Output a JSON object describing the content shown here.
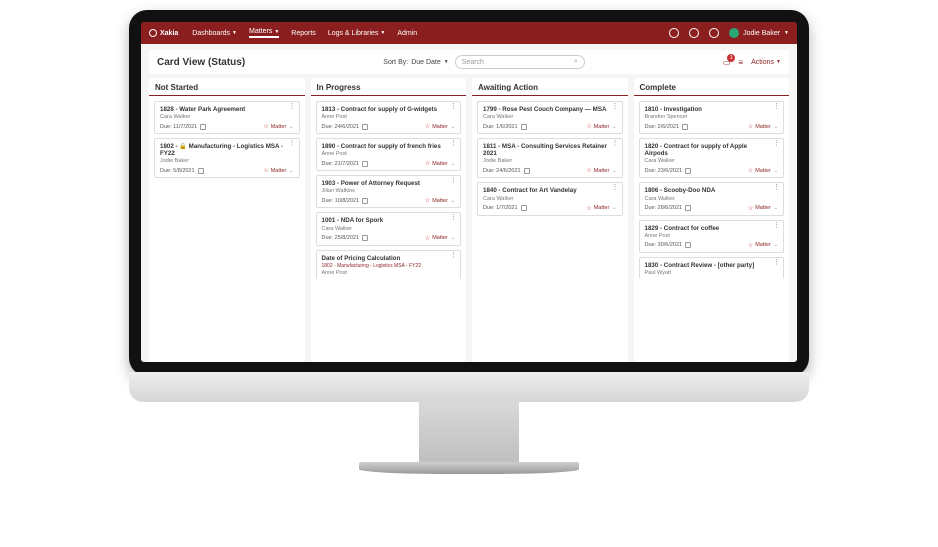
{
  "brand": "Xakia",
  "nav": {
    "items": [
      {
        "label": "Dashboards",
        "caret": true
      },
      {
        "label": "Matters",
        "caret": true,
        "active": true
      },
      {
        "label": "Reports",
        "caret": false
      },
      {
        "label": "Logs & Libraries",
        "caret": true
      },
      {
        "label": "Admin",
        "caret": false
      }
    ]
  },
  "user": {
    "name": "Jodie Baker"
  },
  "view": {
    "title": "Card View (Status)",
    "sort_label": "Sort By:",
    "sort_value": "Due Date",
    "search_placeholder": "Search",
    "actions_label": "Actions",
    "badge_count": "1"
  },
  "columns": [
    {
      "name": "Not Started",
      "cards": [
        {
          "title": "1828 - Water Park Agreement",
          "assignee": "Cara Walker",
          "due": "Due: 11/7/2021",
          "tag": "Matter"
        },
        {
          "title": "1802 - 🔒 Manufacturing - Logistics MSA - FY22",
          "assignee": "Jodie Baker",
          "due": "Due: 5/8/2021",
          "tag": "Matter"
        }
      ]
    },
    {
      "name": "In Progress",
      "cards": [
        {
          "title": "1813 - Contract for supply of G-widgets",
          "assignee": "Anne Post",
          "due": "Due: 24/6/2021",
          "tag": "Matter"
        },
        {
          "title": "1890 - Contract for supply of french fries",
          "assignee": "Anne Post",
          "due": "Due: 21/7/2021",
          "tag": "Matter"
        },
        {
          "title": "1903 - Power of Attorney Request",
          "assignee": "Jilian Watkins",
          "due": "Due: 10/8/2021",
          "tag": "Matter"
        },
        {
          "title": "1001 - NDA for Spork",
          "assignee": "Cara Walker",
          "due": "Due: 25/8/2021",
          "tag": "Matter"
        },
        {
          "title": "Date of Pricing Calculation",
          "extra": "1802 - Manufacturing - Logistics MSA - FY22",
          "assignee": "Anne Post",
          "partial": true
        }
      ]
    },
    {
      "name": "Awaiting Action",
      "cards": [
        {
          "title": "1799 - Rose Pest Couch Company — MSA",
          "assignee": "Cara Walker",
          "due": "Due: 1/6/2021",
          "tag": "Matter"
        },
        {
          "title": "1811 - MSA - Consulting Services Retainer 2021",
          "assignee": "Jodie Baker",
          "due": "Due: 24/6/2021",
          "tag": "Matter"
        },
        {
          "title": "1840 - Contract for Art Vandelay",
          "assignee": "Cara Walker",
          "due": "Due: 1/7/2021",
          "tag": "Matter"
        }
      ]
    },
    {
      "name": "Complete",
      "cards": [
        {
          "title": "1810 - Investigation",
          "assignee": "Brandon Spencer",
          "due": "Due: 2/6/2021",
          "tag": "Matter"
        },
        {
          "title": "1820 - Contract for supply of Apple Airpods",
          "assignee": "Cara Walker",
          "due": "Due: 23/6/2021",
          "tag": "Matter"
        },
        {
          "title": "1806 - Scooby-Doo NDA",
          "assignee": "Cara Walker",
          "due": "Due: 28/6/2021",
          "tag": "Matter"
        },
        {
          "title": "1829 - Contract for coffee",
          "assignee": "Anne Post",
          "due": "Due: 30/6/2021",
          "tag": "Matter"
        },
        {
          "title": "1830 - Contract Review - [other party]",
          "assignee": "Paul Wyatt",
          "partial": true
        }
      ]
    }
  ]
}
